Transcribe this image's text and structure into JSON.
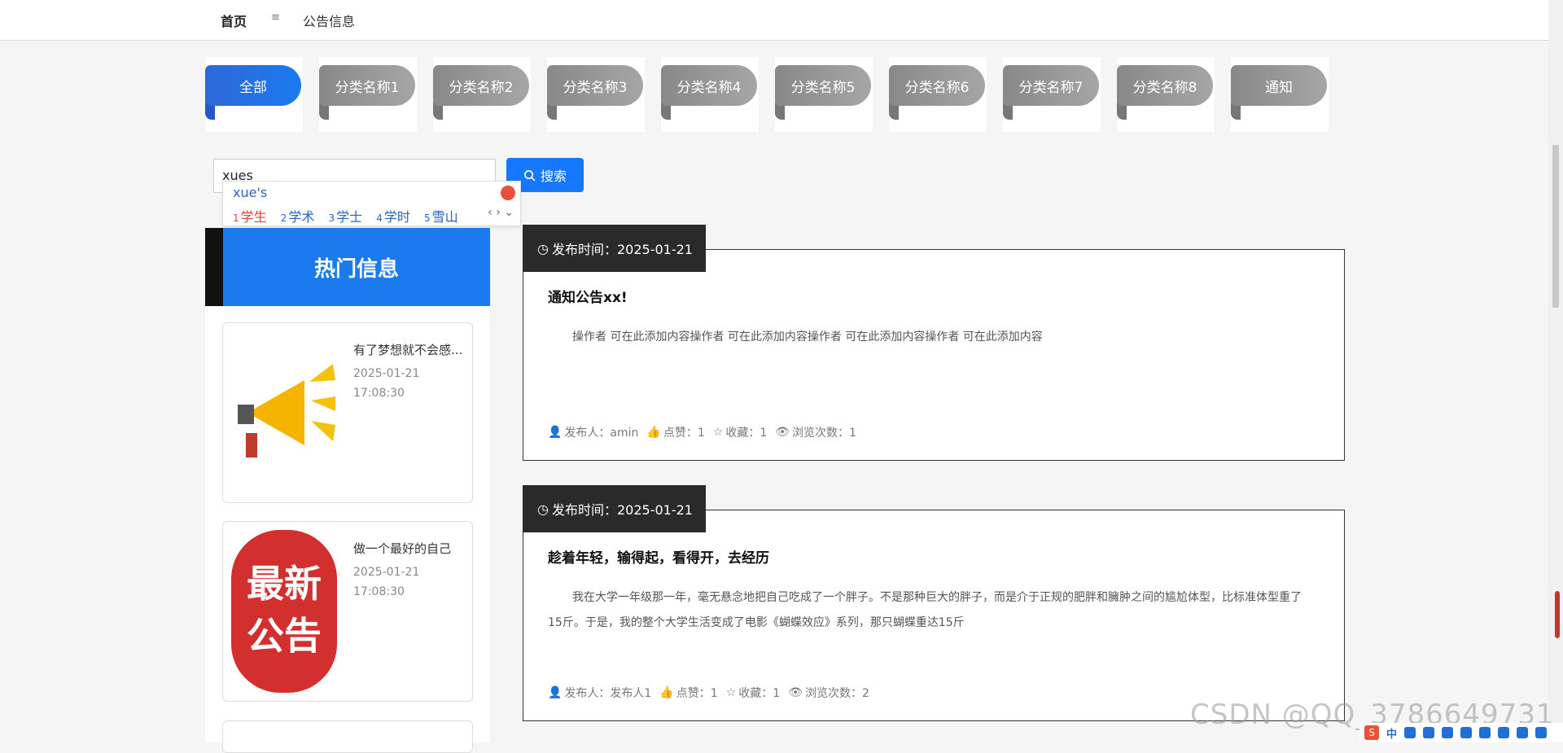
{
  "nav": {
    "home": "首页",
    "separator": "≡",
    "current": "公告信息"
  },
  "categories": [
    {
      "label": "全部",
      "active": true
    },
    {
      "label": "分类名称1",
      "active": false
    },
    {
      "label": "分类名称2",
      "active": false
    },
    {
      "label": "分类名称3",
      "active": false
    },
    {
      "label": "分类名称4",
      "active": false
    },
    {
      "label": "分类名称5",
      "active": false
    },
    {
      "label": "分类名称6",
      "active": false
    },
    {
      "label": "分类名称7",
      "active": false
    },
    {
      "label": "分类名称8",
      "active": false
    },
    {
      "label": "通知",
      "active": false
    }
  ],
  "search": {
    "value": "xues",
    "button_label": "搜索"
  },
  "ime": {
    "composition": "xue's",
    "candidates": [
      {
        "index": "1",
        "text": "学生"
      },
      {
        "index": "2",
        "text": "学术"
      },
      {
        "index": "3",
        "text": "学士"
      },
      {
        "index": "4",
        "text": "学时"
      },
      {
        "index": "5",
        "text": "雪山"
      }
    ]
  },
  "hot": {
    "title": "热门信息",
    "items": [
      {
        "title": "有了梦想就不会感...",
        "date": "2025-01-21",
        "time": "17:08:30",
        "image": "megaphone-image"
      },
      {
        "title": "做一个最好的自己",
        "date": "2025-01-21",
        "time": "17:08:30",
        "image": "latest-notice-image",
        "image_text": [
          "最新",
          "公告"
        ]
      }
    ]
  },
  "posts": [
    {
      "publish_label": "发布时间：2025-01-21",
      "title": "通知公告xx!",
      "body": "操作者 可在此添加内容操作者 可在此添加内容操作者 可在此添加内容操作者 可在此添加内容",
      "author": "发布人：amin",
      "likes": "点赞：1",
      "favorites": "收藏：1",
      "views": "浏览次数：1"
    },
    {
      "publish_label": "发布时间：2025-01-21",
      "title": "趁着年轻，输得起，看得开，去经历",
      "body": "我在大学一年级那一年，毫无悬念地把自己吃成了一个胖子。不是那种巨大的胖子，而是介于正规的肥胖和臃肿之间的尴尬体型，比标准体型重了15斤。于是，我的整个大学生活变成了电影《蝴蝶效应》系列，那只蝴蝶重达15斤",
      "author": "发布人：发布人1",
      "likes": "点赞：1",
      "favorites": "收藏：1",
      "views": "浏览次数：2"
    }
  ],
  "watermark": "CSDN @QQ_3786649731",
  "tray": {
    "ime_mode": "中"
  },
  "colors": {
    "primary": "#1677ff",
    "active_category": "#1a7aee",
    "hot_header": "#1a7aee",
    "badge": "#2a2a2a",
    "ime_selected": "#e0402f"
  }
}
